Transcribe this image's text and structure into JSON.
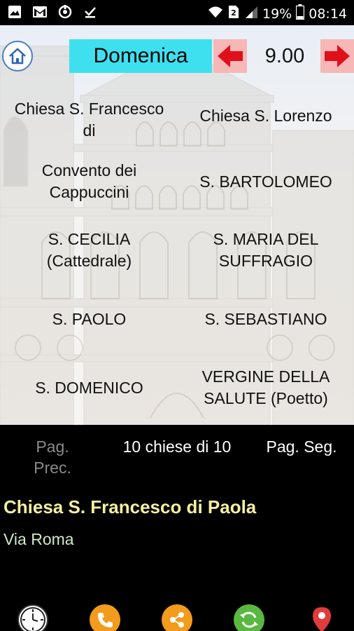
{
  "status_bar": {
    "battery_percent": "19%",
    "time": "08:14",
    "icons": [
      "image-icon",
      "gmail-icon",
      "sync-icon",
      "download-done-icon",
      "wifi-icon",
      "sim-2-icon",
      "signal-icon",
      "battery-icon"
    ]
  },
  "header": {
    "day": "Domenica",
    "time": "9.00"
  },
  "churches": [
    {
      "label": "Chiesa S. Francesco di"
    },
    {
      "label": "Chiesa S. Lorenzo"
    },
    {
      "label": "Convento dei Cappuccini"
    },
    {
      "label": "S. BARTOLOMEO"
    },
    {
      "label": "S. CECILIA (Cattedrale)"
    },
    {
      "label": "S. MARIA DEL SUFFRAGIO"
    },
    {
      "label": "S. PAOLO"
    },
    {
      "label": "S. SEBASTIANO"
    },
    {
      "label": "S. DOMENICO"
    },
    {
      "label": "VERGINE DELLA SALUTE (Poetto)"
    }
  ],
  "pager": {
    "prev_label": "Pag. Prec.",
    "count_label": "10 chiese di 10",
    "next_label": "Pag. Seg."
  },
  "detail": {
    "title": "Chiesa S. Francesco di Paola",
    "address": "Via Roma"
  },
  "bottom_bar": {
    "icons": [
      "clock-icon",
      "phone-icon",
      "share-icon",
      "refresh-icon",
      "map-pin-icon"
    ]
  },
  "colors": {
    "day_box": "#3ee0f0",
    "arrow_bg": "#f7b7b7",
    "arrow": "#e0101a",
    "detail_title": "#f5f0a0",
    "detail_address": "#cfe9c8",
    "pager_disabled": "#8a8a8a"
  }
}
